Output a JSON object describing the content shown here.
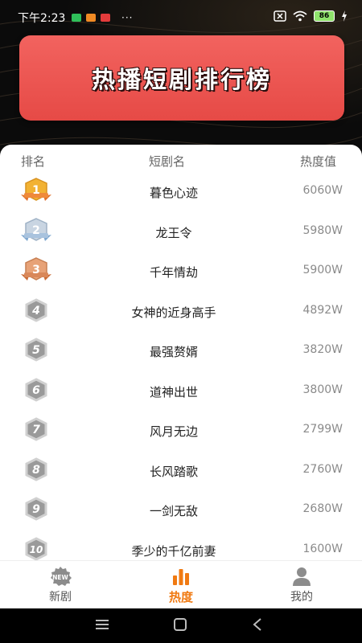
{
  "status_bar": {
    "time": "下午2:23",
    "battery": "86",
    "more": "···"
  },
  "banner": {
    "title": "热播短剧排行榜"
  },
  "table": {
    "headers": {
      "rank": "排名",
      "name": "短剧名",
      "heat": "热度值"
    },
    "rows": [
      {
        "rank": "1",
        "name": "暮色心迹",
        "heat": "6060W"
      },
      {
        "rank": "2",
        "name": "龙王令",
        "heat": "5980W"
      },
      {
        "rank": "3",
        "name": "千年情劫",
        "heat": "5900W"
      },
      {
        "rank": "4",
        "name": "女神的近身高手",
        "heat": "4892W"
      },
      {
        "rank": "5",
        "name": "最强赘婿",
        "heat": "3820W"
      },
      {
        "rank": "6",
        "name": "道神出世",
        "heat": "3800W"
      },
      {
        "rank": "7",
        "name": "风月无边",
        "heat": "2799W"
      },
      {
        "rank": "8",
        "name": "长风踏歌",
        "heat": "2760W"
      },
      {
        "rank": "9",
        "name": "一剑无敌",
        "heat": "2680W"
      },
      {
        "rank": "10",
        "name": "季少的千亿前妻",
        "heat": "1600W"
      }
    ]
  },
  "tabbar": {
    "tabs": [
      {
        "label": "新剧",
        "icon": "new-badge-icon",
        "badge_text": "NEW"
      },
      {
        "label": "热度",
        "icon": "bar-chart-icon"
      },
      {
        "label": "我的",
        "icon": "user-icon"
      }
    ],
    "active_index": 1,
    "active_color": "#f07a12"
  },
  "colors": {
    "banner_red": "#e64a46",
    "gold": "#f2b233",
    "silver": "#b9c7d6",
    "bronze": "#d9885a",
    "gray_badge": "#b0b0b0"
  }
}
